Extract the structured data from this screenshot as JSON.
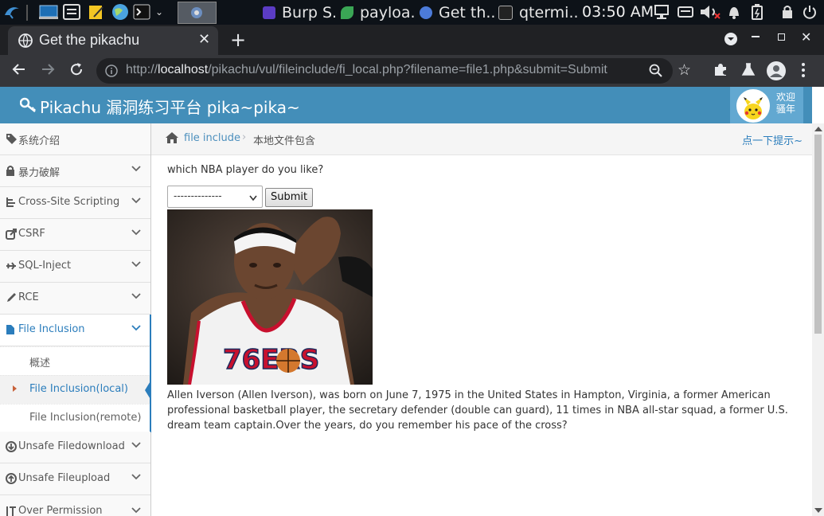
{
  "taskbar": {
    "tasks": [
      {
        "label": "Burp S..."
      },
      {
        "label": "payloa..."
      },
      {
        "label": "Get th..."
      },
      {
        "label": "qtermi..."
      }
    ],
    "clock": "03:50 AM"
  },
  "browser": {
    "tab_title": "Get the pikachu",
    "url_prefix": "http://",
    "url_host": "localhost",
    "url_path": "/pikachu/vul/fileinclude/fi_local.php?filename=file1.php&submit=Submit"
  },
  "app": {
    "title": "Pikachu 漏洞练习平台 pika~pika~",
    "welcome_line1": "欢迎",
    "welcome_line2": "骚年"
  },
  "sidebar": {
    "items": [
      {
        "label": "系统介绍"
      },
      {
        "label": "暴力破解"
      },
      {
        "label": "Cross-Site Scripting"
      },
      {
        "label": "CSRF"
      },
      {
        "label": "SQL-Inject"
      },
      {
        "label": "RCE"
      },
      {
        "label": "File Inclusion"
      },
      {
        "label": "Unsafe Filedownload"
      },
      {
        "label": "Unsafe Fileupload"
      },
      {
        "label": "Over Permission"
      }
    ],
    "subitems": [
      {
        "label": "概述"
      },
      {
        "label": "File Inclusion(local)"
      },
      {
        "label": "File Inclusion(remote)"
      }
    ]
  },
  "breadcrumb": {
    "link": "file include",
    "current": "本地文件包含",
    "hint": "点一下提示~"
  },
  "main": {
    "question": "which NBA player do you like?",
    "select_value": "--------------",
    "submit_label": "Submit",
    "description": "Allen Iverson (Allen Iverson), was born on June 7, 1975 in the United States in Hampton, Virginia, a former American professional basketball player, the secretary defender (double can guard), 11 times in NBA all-star squad, a former U.S. dream team captain.Over the years, do you remember his pace of the cross?",
    "photo_jersey_text": "76ERS"
  }
}
